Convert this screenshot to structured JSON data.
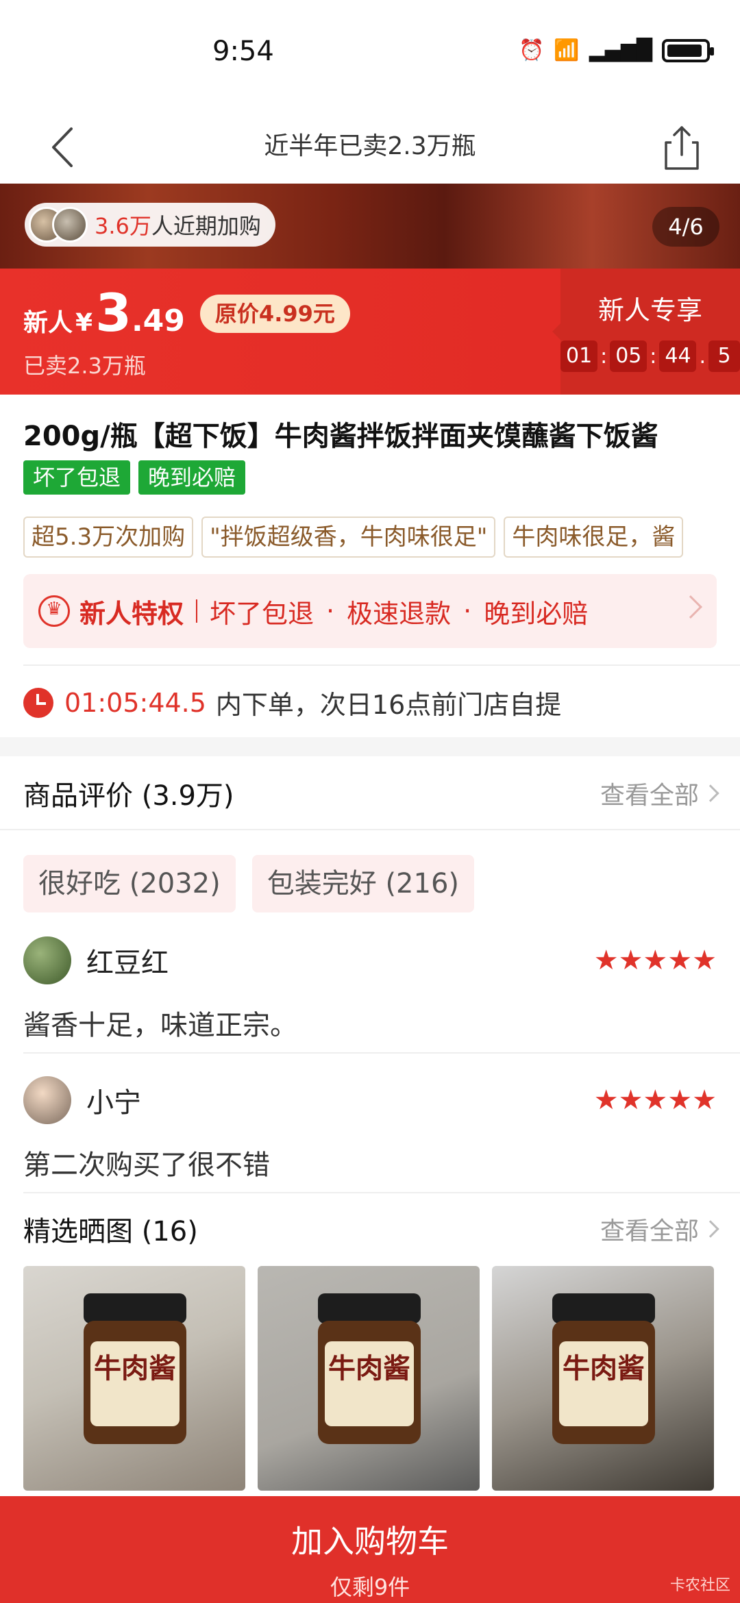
{
  "status_bar": {
    "time": "9:54",
    "icons": [
      "alarm-icon",
      "wifi-icon",
      "signal-4g-icon",
      "battery-icon"
    ]
  },
  "header": {
    "title": "近半年已卖2.3万瓶"
  },
  "hero": {
    "buyers_count": "3.6万",
    "buyers_text": "人近期加购",
    "image_counter": "4/6"
  },
  "price": {
    "prefix": "新人",
    "currency": "¥",
    "integer": "3",
    "decimal": ".49",
    "original": "原价4.99元",
    "sold": "已卖2.3万瓶",
    "exclusive_label": "新人专享",
    "countdown": {
      "h": "01",
      "m": "05",
      "s": "44",
      "ms": "5"
    }
  },
  "product": {
    "title": "200g/瓶【超下饭】牛肉酱拌饭拌面夹馍蘸酱下饭酱",
    "guarantee_tags": [
      "坏了包退",
      "晚到必赔"
    ],
    "highlights": [
      "超5.3万次加购",
      "\"拌饭超级香，牛肉味很足\"",
      "牛肉味很足，酱"
    ],
    "privilege": {
      "title": "新人特权",
      "items": [
        "坏了包退",
        "极速退款",
        "晚到必赔"
      ]
    },
    "pickup": {
      "time": "01:05:44.5",
      "text": "内下单，次日16点前门店自提"
    }
  },
  "reviews": {
    "title": "商品评价 (3.9万)",
    "see_all": "查看全部",
    "keywords": [
      "很好吃 (2032)",
      "包装完好 (216)"
    ],
    "items": [
      {
        "name": "红豆红",
        "stars": "★★★★★",
        "text": "酱香十足，味道正宗。"
      },
      {
        "name": "小宁",
        "stars": "★★★★★",
        "text": "第二次购买了很不错"
      }
    ],
    "photos_title": "精选晒图 (16)",
    "photos_see_all": "查看全部",
    "jar_label": "牛肉酱"
  },
  "cart": {
    "label": "加入购物车",
    "stock": "仅剩9件"
  },
  "watermark": "卡农社区",
  "colors": {
    "brand_red": "#e0302a",
    "green_tag": "#1ea836",
    "star": "#e0332a"
  }
}
